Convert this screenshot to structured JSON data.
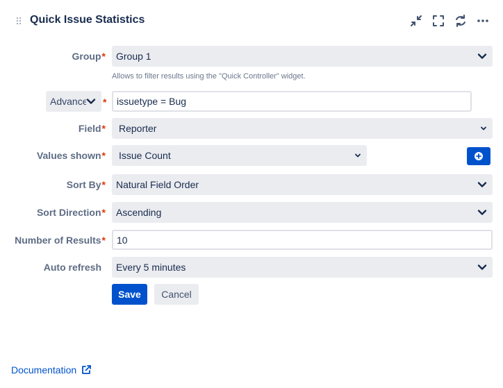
{
  "header": {
    "title": "Quick Issue Statistics",
    "icons": [
      "drag-handle-icon",
      "minimize-icon",
      "fullscreen-icon",
      "refresh-icon",
      "more-icon"
    ]
  },
  "form": {
    "group": {
      "label": "Group",
      "required_mark": "*",
      "value": "Group 1",
      "helper": "Allows to filter results using the \"Quick Controller\" widget."
    },
    "filter": {
      "mode": "Advance",
      "required_mark": "*",
      "value": "issuetype = Bug"
    },
    "field": {
      "label": "Field",
      "required_mark": "*",
      "value": "Reporter"
    },
    "values_shown": {
      "label": "Values shown",
      "required_mark": "*",
      "value": "Issue Count"
    },
    "sort_by": {
      "label": "Sort By",
      "required_mark": "*",
      "value": "Natural Field Order"
    },
    "sort_direction": {
      "label": "Sort Direction",
      "required_mark": "*",
      "value": "Ascending"
    },
    "number_of_results": {
      "label": "Number of Results",
      "required_mark": "*",
      "value": "10"
    },
    "auto_refresh": {
      "label": "Auto refresh",
      "value": "Every 5 minutes"
    }
  },
  "actions": {
    "save": "Save",
    "cancel": "Cancel"
  },
  "footer": {
    "documentation": "Documentation"
  },
  "colors": {
    "primary": "#0052cc",
    "required": "#de350b",
    "field_bg": "#ebecf0",
    "label": "#5e6c84"
  }
}
